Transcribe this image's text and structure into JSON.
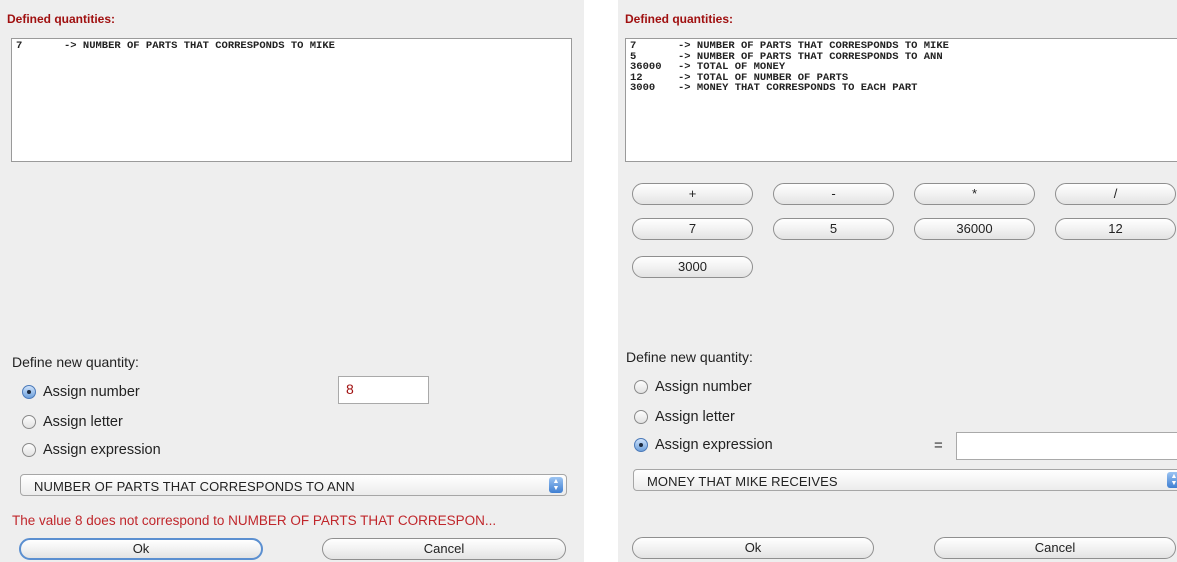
{
  "left": {
    "defined_label": "Defined quantities:",
    "quantities": [
      {
        "value": "7",
        "description": "-> NUMBER OF PARTS THAT CORRESPONDS TO MIKE"
      }
    ],
    "define_label": "Define new quantity:",
    "options": [
      "Assign number",
      "Assign letter",
      "Assign expression"
    ],
    "selected_option": "Assign number",
    "number_value": "8",
    "select_value": "NUMBER OF PARTS THAT CORRESPONDS TO ANN",
    "error": "The value 8 does not correspond to NUMBER OF PARTS THAT CORRESPON...",
    "ok_label": "Ok",
    "cancel_label": "Cancel"
  },
  "right": {
    "defined_label": "Defined quantities:",
    "quantities": [
      {
        "value": "7",
        "description": "-> NUMBER OF PARTS THAT CORRESPONDS TO MIKE"
      },
      {
        "value": "5",
        "description": "-> NUMBER OF PARTS THAT CORRESPONDS TO ANN"
      },
      {
        "value": "36000",
        "description": "-> TOTAL OF MONEY"
      },
      {
        "value": "12",
        "description": "-> TOTAL OF NUMBER OF PARTS"
      },
      {
        "value": "3000",
        "description": "-> MONEY THAT CORRESPONDS TO EACH PART"
      }
    ],
    "operators": [
      "+",
      "-",
      "*",
      "/"
    ],
    "value_buttons": [
      "7",
      "5",
      "36000",
      "12",
      "3000"
    ],
    "define_label": "Define new quantity:",
    "options": [
      "Assign number",
      "Assign letter",
      "Assign expression"
    ],
    "selected_option": "Assign expression",
    "equals_sign": "=",
    "expression_value": "",
    "select_value": "MONEY THAT MIKE RECEIVES",
    "ok_label": "Ok",
    "cancel_label": "Cancel"
  }
}
